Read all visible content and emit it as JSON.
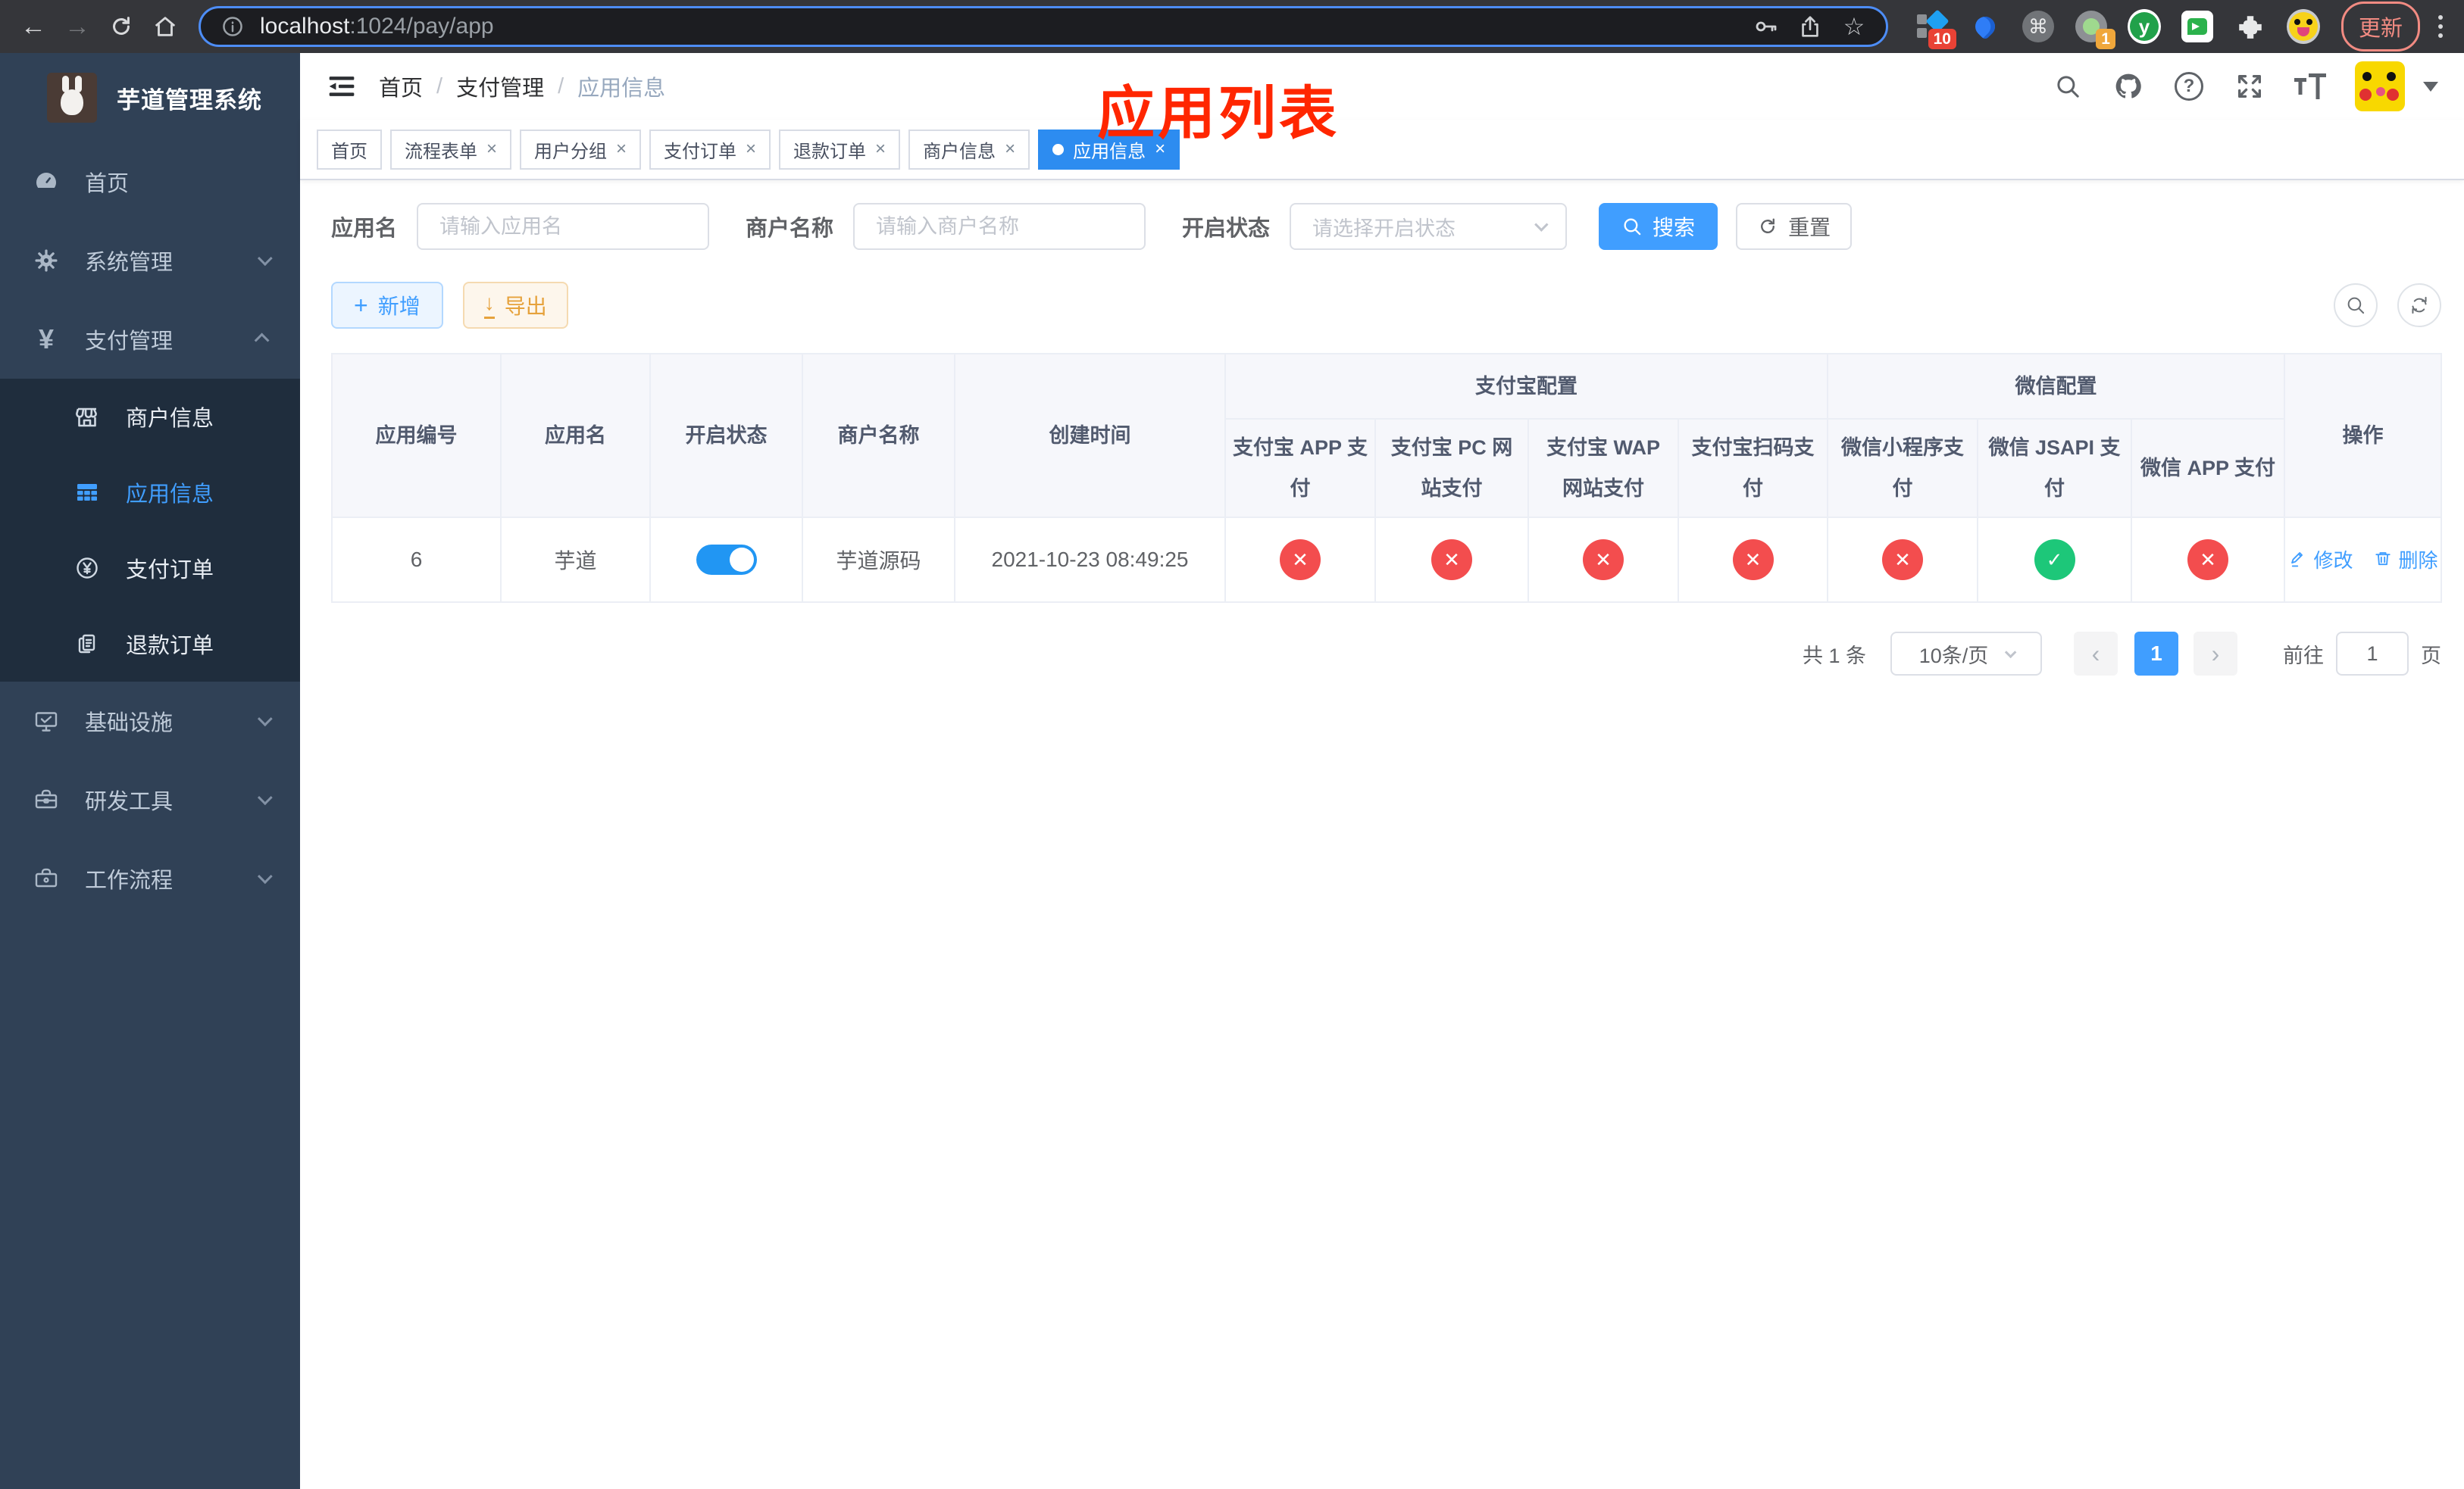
{
  "colors": {
    "accent": "#409eff",
    "success": "#1dc779",
    "danger": "#f34d4e",
    "warning": "#e6a23c",
    "title_red": "#ff2600",
    "sidebar_bg": "#304156",
    "submenu_bg": "#1f2d3d"
  },
  "glyphs": {
    "back": "←",
    "forward": "→",
    "star": "☆",
    "command": "⌘",
    "check": "✓",
    "cross": "✕",
    "close": "×",
    "dot": "●",
    "chevron_left": "‹",
    "chevron_right": "›",
    "plus": "+",
    "down_arrow": "↓",
    "question": "?",
    "slash": "/",
    "y_letter": "y"
  },
  "browser": {
    "url_host": "localhost",
    "url_path": ":1024/pay/app",
    "update_label": "更新",
    "ext_badge_blue_diamond": "10",
    "ext_badge_camera": "1"
  },
  "sidebar": {
    "logo_title": "芋道管理系统",
    "items": [
      {
        "label": "首页",
        "icon": "dashboard"
      },
      {
        "label": "系统管理",
        "icon": "gear",
        "expandable": true
      },
      {
        "label": "支付管理",
        "icon": "yen",
        "expanded": true
      },
      {
        "label": "商户信息",
        "icon": "shop",
        "sub": true
      },
      {
        "label": "应用信息",
        "icon": "grid",
        "sub": true,
        "active": true
      },
      {
        "label": "支付订单",
        "icon": "yen-circle",
        "sub": true
      },
      {
        "label": "退款订单",
        "icon": "documents",
        "sub": true
      },
      {
        "label": "基础设施",
        "icon": "monitor-check",
        "expandable": true
      },
      {
        "label": "研发工具",
        "icon": "toolbox",
        "expandable": true
      },
      {
        "label": "工作流程",
        "icon": "briefcase",
        "expandable": true
      }
    ]
  },
  "header": {
    "breadcrumb": [
      "首页",
      "支付管理",
      "应用信息"
    ],
    "overlay_title": "应用列表"
  },
  "tabs": {
    "close_glyph": "×",
    "items": [
      {
        "label": "首页",
        "closable": false
      },
      {
        "label": "流程表单",
        "closable": true
      },
      {
        "label": "用户分组",
        "closable": true
      },
      {
        "label": "支付订单",
        "closable": true
      },
      {
        "label": "退款订单",
        "closable": true
      },
      {
        "label": "商户信息",
        "closable": true
      },
      {
        "label": "应用信息",
        "closable": true,
        "active": true
      }
    ]
  },
  "search": {
    "app_name_label": "应用名",
    "app_name_placeholder": "请输入应用名",
    "merchant_label": "商户名称",
    "merchant_placeholder": "请输入商户名称",
    "status_label": "开启状态",
    "status_placeholder": "请选择开启状态",
    "search_label": "搜索",
    "reset_label": "重置"
  },
  "toolbar": {
    "add_label": "新增",
    "export_label": "导出"
  },
  "table": {
    "main_headers": [
      "应用编号",
      "应用名",
      "开启状态",
      "商户名称",
      "创建时间"
    ],
    "group_headers": [
      "支付宝配置",
      "微信配置"
    ],
    "sub_headers": [
      "支付宝 APP 支付",
      "支付宝 PC 网站支付",
      "支付宝 WAP 网站支付",
      "支付宝扫码支付",
      "微信小程序支付",
      "微信 JSAPI 支付",
      "微信 APP 支付"
    ],
    "op_header": "操作",
    "rows": [
      {
        "id": "6",
        "name": "芋道",
        "enabled": true,
        "merchant": "芋道源码",
        "created": "2021-10-23 08:49:25",
        "statuses": [
          false,
          false,
          false,
          false,
          false,
          true,
          false
        ],
        "edit_label": "修改",
        "delete_label": "删除"
      }
    ]
  },
  "pagination": {
    "total_label": "共 1 条",
    "page_size_label": "10条/页",
    "current_page": "1",
    "goto_label": "前往",
    "goto_value": "1",
    "page_unit_label": "页"
  }
}
